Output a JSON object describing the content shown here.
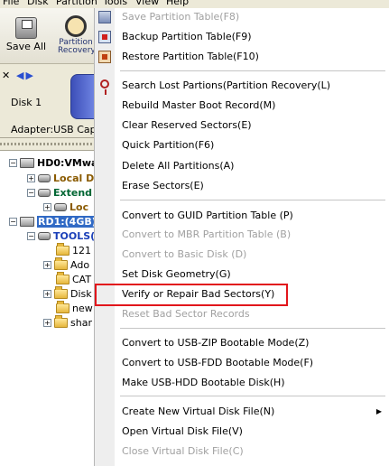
{
  "menubar": {
    "items": [
      "File",
      "Disk",
      "Partition",
      "Tools",
      "View",
      "Help"
    ]
  },
  "toolbar": {
    "save_all": "Save All",
    "partition_recovery": "Partition Recovery"
  },
  "disk_panel": {
    "disk_label": "Disk  1",
    "adapter_text": "Adapter:USB  Capa"
  },
  "tree": {
    "nodes": [
      {
        "label": "HD0:VMwa",
        "style": "disk"
      },
      {
        "label": "Local D",
        "style": "brown"
      },
      {
        "label": "Extend",
        "style": "green"
      },
      {
        "label": "Loc",
        "style": "brown"
      },
      {
        "label": "RD1:(4GB)",
        "style": "selected"
      },
      {
        "label": "TOOLS(",
        "style": "blue"
      },
      {
        "label": "121",
        "style": "folder"
      },
      {
        "label": "Ado",
        "style": "folder"
      },
      {
        "label": "CAT",
        "style": "folder"
      },
      {
        "label": "Disk",
        "style": "folder"
      },
      {
        "label": "new",
        "style": "folder"
      },
      {
        "label": "shar",
        "style": "folder"
      }
    ]
  },
  "context_menu": {
    "items": [
      {
        "label": "Save Partition Table(F8)",
        "disabled": true
      },
      {
        "label": "Backup Partition Table(F9)",
        "disabled": false
      },
      {
        "label": "Restore Partition Table(F10)",
        "disabled": false
      },
      {
        "label": "Search Lost Partions(Partition Recovery(L)",
        "disabled": false
      },
      {
        "label": "Rebuild Master Boot Record(M)",
        "disabled": false
      },
      {
        "label": "Clear Reserved Sectors(E)",
        "disabled": false
      },
      {
        "label": "Quick Partition(F6)",
        "disabled": false
      },
      {
        "label": "Delete All Partitions(A)",
        "disabled": false
      },
      {
        "label": "Erase Sectors(E)",
        "disabled": false
      },
      {
        "label": "Convert to GUID Partition Table (P)",
        "disabled": false
      },
      {
        "label": "Convert to MBR Partition Table (B)",
        "disabled": true
      },
      {
        "label": "Convert to Basic Disk (D)",
        "disabled": true
      },
      {
        "label": "Set Disk Geometry(G)",
        "disabled": false
      },
      {
        "label": "Verify or Repair Bad Sectors(Y)",
        "disabled": false
      },
      {
        "label": "Reset Bad Sector Records",
        "disabled": true
      },
      {
        "label": "Convert to USB-ZIP Bootable Mode(Z)",
        "disabled": false
      },
      {
        "label": "Convert to USB-FDD Bootable Mode(F)",
        "disabled": false
      },
      {
        "label": "Make USB-HDD Bootable Disk(H)",
        "disabled": false
      },
      {
        "label": "Create New Virtual Disk File(N)",
        "disabled": false
      },
      {
        "label": "Open Virtual Disk File(V)",
        "disabled": false
      },
      {
        "label": "Close Virtual Disk File(C)",
        "disabled": true
      }
    ]
  }
}
